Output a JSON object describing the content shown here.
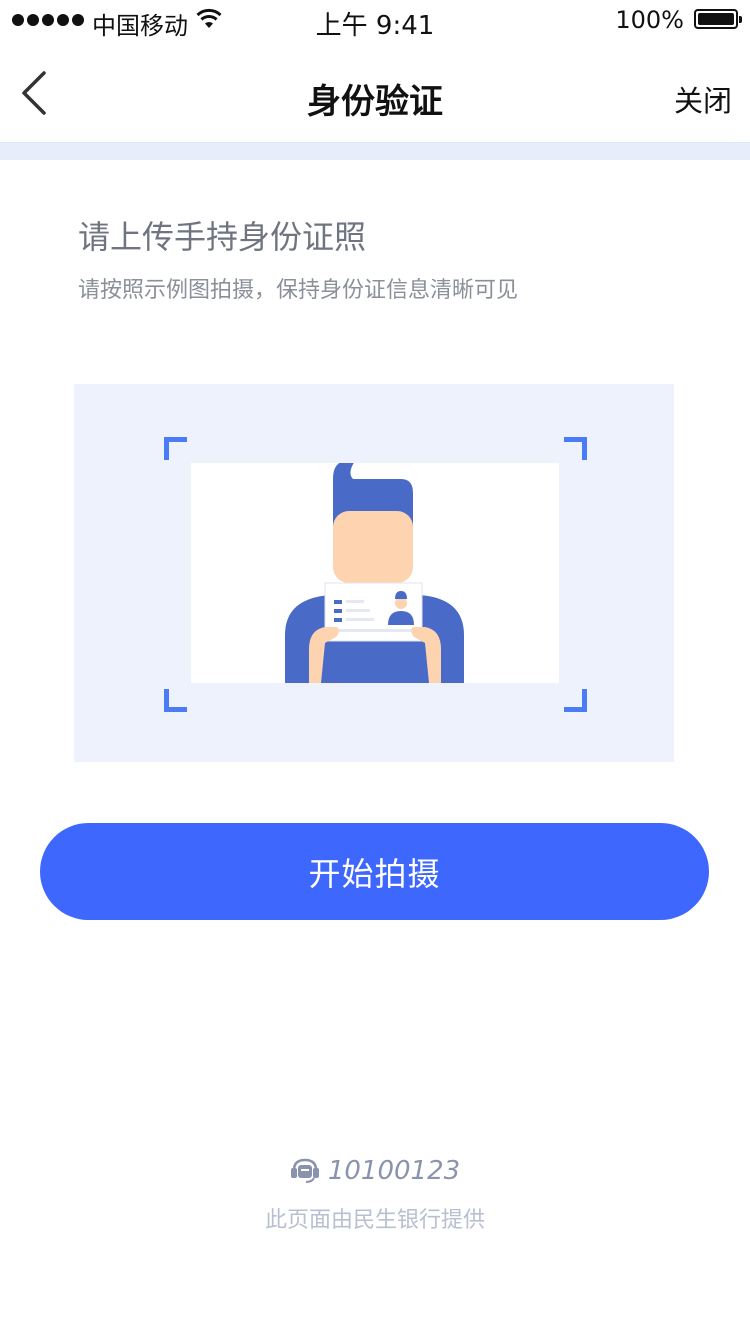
{
  "status_bar": {
    "carrier": "中国移动",
    "time": "上午 9:41",
    "battery": "100%"
  },
  "nav": {
    "title": "身份验证",
    "close_label": "关闭",
    "back_icon": "chevron-left-icon"
  },
  "content": {
    "heading": "请上传手持身份证照",
    "subheading": "请按照示例图拍摄，保持身份证信息清晰可见"
  },
  "actions": {
    "start_label": "开始拍摄"
  },
  "footer": {
    "hotline_icon": "customer-service-icon",
    "hotline_number": "10100123",
    "provider_text": "此页面由民生银行提供"
  },
  "colors": {
    "accent": "#3e67fd",
    "frame_corner": "#4c7cf5",
    "illustration_bg": "#edf2fd",
    "person_blue": "#4a6ac8",
    "skin": "#fdd3b0"
  }
}
